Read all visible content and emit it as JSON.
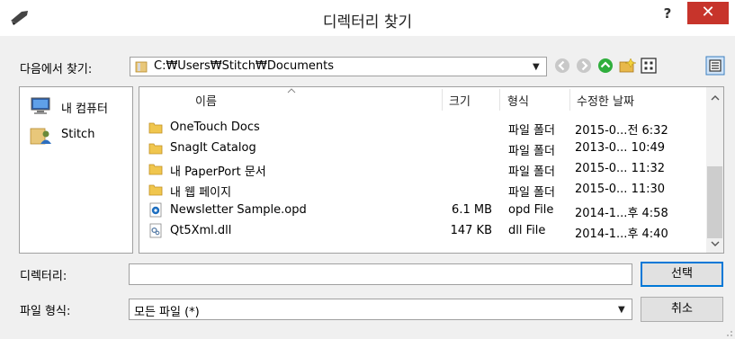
{
  "window": {
    "title": "디렉터리 찾기",
    "help": "?",
    "close": "✕"
  },
  "lookin": {
    "label": "다음에서 찾기:",
    "path": "C:₩Users₩Stitch₩Documents"
  },
  "places": [
    {
      "label": "내 컴퓨터",
      "icon": "computer-icon"
    },
    {
      "label": "Stitch",
      "icon": "user-folder-icon"
    }
  ],
  "columns": {
    "name": "이름",
    "size": "크기",
    "type": "형식",
    "date": "수정한 날짜"
  },
  "files": [
    {
      "name": "OneTouch Docs",
      "size": "",
      "type": "파일 폴더",
      "date": "2015-0...전 6:32",
      "icon": "folder-icon"
    },
    {
      "name": "SnagIt Catalog",
      "size": "",
      "type": "파일 폴더",
      "date": "2013-0... 10:49",
      "icon": "folder-icon"
    },
    {
      "name": "내 PaperPort 문서",
      "size": "",
      "type": "파일 폴더",
      "date": "2015-0... 11:32",
      "icon": "folder-icon"
    },
    {
      "name": "내 웹 페이지",
      "size": "",
      "type": "파일 폴더",
      "date": "2015-0... 11:30",
      "icon": "folder-icon"
    },
    {
      "name": "Newsletter Sample.opd",
      "size": "6.1 MB",
      "type": "opd File",
      "date": "2014-1...후 4:58",
      "icon": "opd-file-icon"
    },
    {
      "name": "Qt5Xml.dll",
      "size": "147 KB",
      "type": "dll File",
      "date": "2014-1...후 4:40",
      "icon": "dll-file-icon"
    }
  ],
  "directory": {
    "label": "디렉터리:",
    "value": ""
  },
  "filetype": {
    "label": "파일 형식:",
    "value": "모든 파일 (*)"
  },
  "buttons": {
    "select": "선택",
    "cancel": "취소"
  }
}
